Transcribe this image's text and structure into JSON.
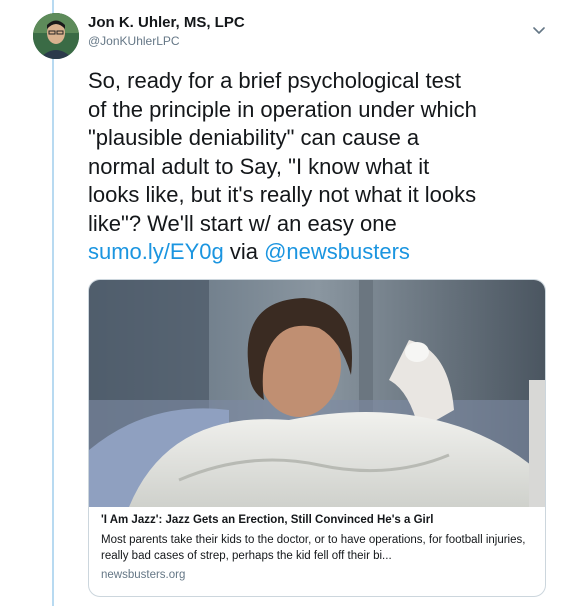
{
  "author": {
    "name": "Jon K. Uhler, MS, LPC",
    "handle": "@JonKUhlerLPC"
  },
  "tweet": {
    "text": "So, ready for a brief psychological test\nof the principle in operation under which\n\"plausible deniability\" can cause a\nnormal adult to Say, \"I know what it\nlooks like, but it's really not what it looks\nlike\"? We'll start w/ an easy one\n",
    "link": "sumo.ly/EY0g",
    "via": " via ",
    "mention": "@newsbusters"
  },
  "card": {
    "title": "'I Am Jazz': Jazz Gets an Erection, Still Convinced He's a Girl",
    "description": "Most parents take their kids to the doctor, or to have operations, for football injuries, really bad cases of strep, perhaps the kid fell off their bi...",
    "domain": "newsbusters.org"
  },
  "icons": {
    "menu": "chevron-down-icon"
  },
  "colors": {
    "link": "#1b95e0",
    "thread_line": "#b8daf1",
    "secondary_text": "#657786",
    "border": "#ccd6dd"
  }
}
